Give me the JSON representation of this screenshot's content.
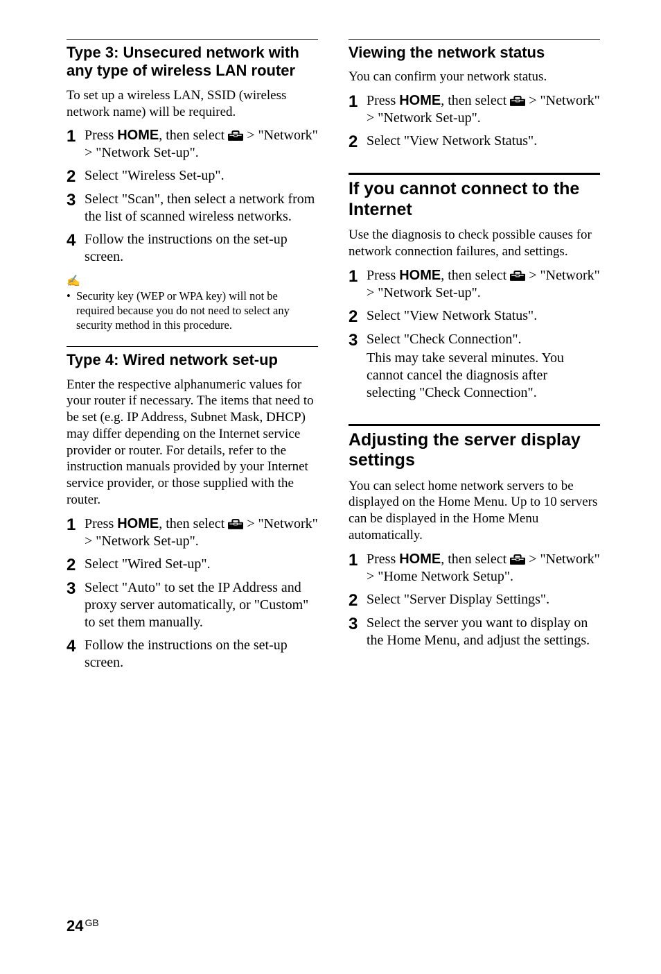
{
  "left": {
    "type3": {
      "heading": "Type 3: Unsecured network with any type of wireless LAN router",
      "intro": "To set up a wireless LAN, SSID (wireless network name) will be required.",
      "steps": [
        {
          "n": "1",
          "pre": "Press ",
          "home": "HOME",
          "post1": ", then select ",
          "post2": " > \"Network\" > \"Network Set-up\"."
        },
        {
          "n": "2",
          "text": "Select \"Wireless Set-up\"."
        },
        {
          "n": "3",
          "text": "Select \"Scan\", then select a network from the list of scanned wireless networks."
        },
        {
          "n": "4",
          "text": "Follow the instructions on the set-up screen."
        }
      ],
      "note_icon": "✍",
      "note": "Security key (WEP or WPA key) will not be required because you do not need to select any security method in this procedure."
    },
    "type4": {
      "heading": "Type 4: Wired network set-up",
      "intro": "Enter the respective alphanumeric values for your router if necessary. The items that need to be set (e.g. IP Address, Subnet Mask, DHCP) may differ depending on the Internet service provider or router. For details, refer to the instruction manuals provided by your Internet service provider, or those supplied with the router.",
      "steps": [
        {
          "n": "1",
          "pre": "Press ",
          "home": "HOME",
          "post1": ", then select ",
          "post2": " > \"Network\" > \"Network Set-up\"."
        },
        {
          "n": "2",
          "text": "Select \"Wired Set-up\"."
        },
        {
          "n": "3",
          "text": "Select \"Auto\" to set the IP Address and proxy server automatically, or \"Custom\" to set them manually."
        },
        {
          "n": "4",
          "text": "Follow the instructions on the set-up screen."
        }
      ]
    }
  },
  "right": {
    "viewing": {
      "heading": "Viewing the network status",
      "intro": "You can confirm your network status.",
      "steps": [
        {
          "n": "1",
          "pre": "Press ",
          "home": "HOME",
          "post1": ", then select ",
          "post2": " > \"Network\" > \"Network Set-up\"."
        },
        {
          "n": "2",
          "text": "Select \"View Network Status\"."
        }
      ]
    },
    "cannot": {
      "heading": "If you cannot connect to the Internet",
      "intro": "Use the diagnosis to check possible causes for network connection failures, and settings.",
      "steps": [
        {
          "n": "1",
          "pre": "Press ",
          "home": "HOME",
          "post1": ", then select ",
          "post2": " > \"Network\" > \"Network Set-up\"."
        },
        {
          "n": "2",
          "text": "Select \"View Network Status\"."
        },
        {
          "n": "3",
          "text": "Select \"Check Connection\".",
          "cont": "This may take several minutes. You cannot cancel the diagnosis after selecting \"Check Connection\"."
        }
      ]
    },
    "adjusting": {
      "heading": "Adjusting the server display settings",
      "intro": "You can select home network servers to be displayed on the Home Menu. Up to 10 servers can be displayed in the Home Menu automatically.",
      "steps": [
        {
          "n": "1",
          "pre": "Press ",
          "home": "HOME",
          "post1": ", then select ",
          "post2": " > \"Network\" > \"Home Network Setup\"."
        },
        {
          "n": "2",
          "text": "Select \"Server Display Settings\"."
        },
        {
          "n": "3",
          "text": "Select the server you want to display on the Home Menu, and adjust the settings."
        }
      ]
    }
  },
  "footer": {
    "page": "24",
    "lang": "GB"
  }
}
